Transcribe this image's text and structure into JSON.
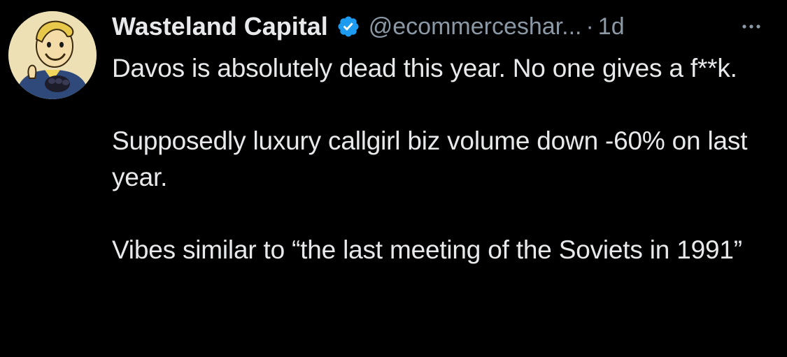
{
  "tweet": {
    "display_name": "Wasteland Capital",
    "handle": "@ecommerceshar...",
    "separator": "·",
    "time": "1d",
    "verified": true,
    "avatar_icon": "vault-boy-avatar",
    "more_icon": "more-horizontal-icon",
    "text": "Davos is absolutely dead this year. No one gives a f**k.\n\nSupposedly luxury callgirl biz volume down -60% on last year.\n\nVibes similar to “the last meeting of the Soviets in 1991”"
  },
  "colors": {
    "background": "#000000",
    "text": "#e7e9ea",
    "muted": "#8b98a5",
    "verified_badge": "#1d9bf0"
  }
}
